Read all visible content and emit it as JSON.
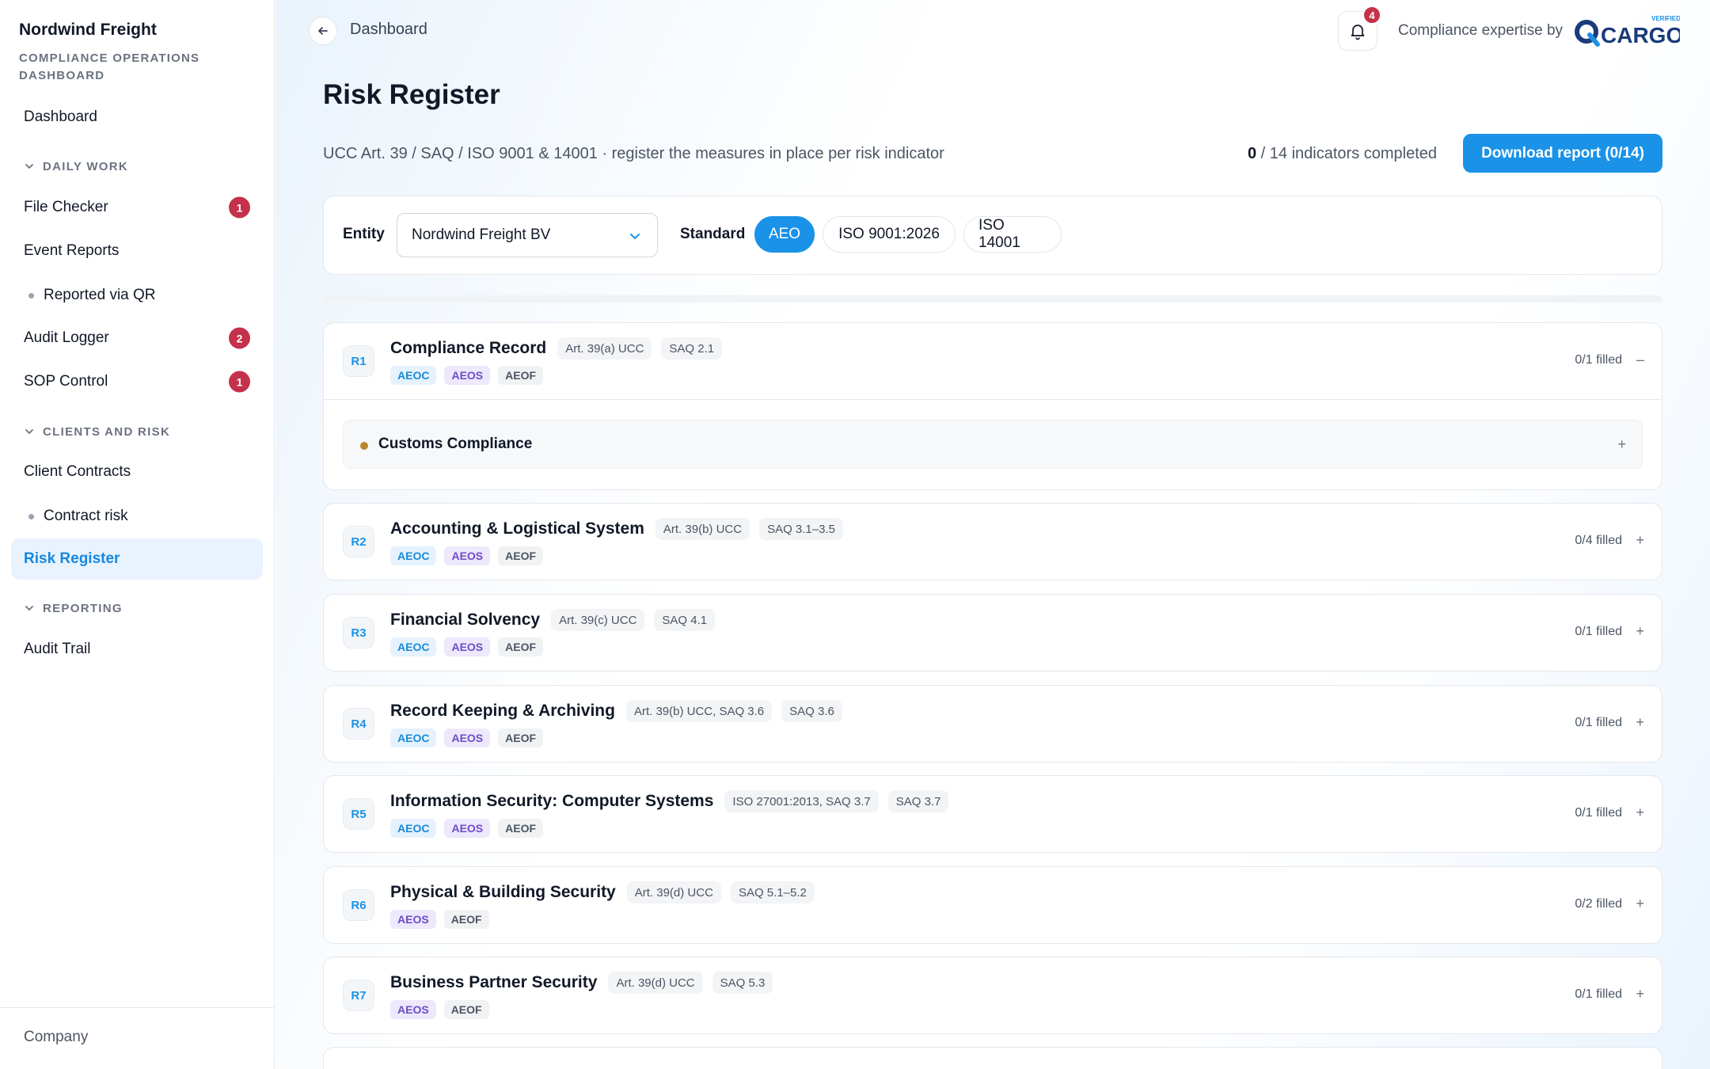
{
  "sidebar": {
    "brand": "Nordwind Freight",
    "brand_sub": "COMPLIANCE OPERATIONS DASHBOARD",
    "dashboard": "Dashboard",
    "sections": {
      "daily": "DAILY WORK",
      "clients": "CLIENTS AND RISK",
      "reporting": "REPORTING"
    },
    "items": {
      "file_checker": {
        "label": "File Checker",
        "badge": "1"
      },
      "event_reports": {
        "label": "Event Reports"
      },
      "reported_qr": {
        "label": "Reported via QR"
      },
      "audit_logger": {
        "label": "Audit Logger",
        "badge": "2"
      },
      "sop_control": {
        "label": "SOP Control",
        "badge": "1"
      },
      "client_contracts": {
        "label": "Client Contracts"
      },
      "contract_risk": {
        "label": "Contract risk"
      },
      "risk_register": {
        "label": "Risk Register"
      },
      "audit_trail": {
        "label": "Audit Trail"
      }
    },
    "footer": "Company"
  },
  "header": {
    "breadcrumb": "Dashboard",
    "notifications": "4",
    "expertise": "Compliance expertise by",
    "logo_text": "CARGO",
    "logo_badge": "VERIFIED"
  },
  "page": {
    "title": "Risk Register",
    "subtitle": "UCC Art. 39 / SAQ / ISO 9001 & 14001 · register the measures in place per risk indicator",
    "completed": "0",
    "completed_rest": " / 14 indicators completed",
    "download": "Download report (0/14)"
  },
  "filters": {
    "entity_label": "Entity",
    "entity_value": "Nordwind Freight BV",
    "standard_label": "Standard",
    "standards": [
      "AEO",
      "ISO 9001:2026",
      "ISO 14001"
    ]
  },
  "risks": [
    {
      "id": "R1",
      "title": "Compliance Record",
      "refs": [
        "Art. 39(a) UCC",
        "SAQ 2.1"
      ],
      "tags": [
        "AEOC",
        "AEOS",
        "AEOF"
      ],
      "filled": "0/1 filled",
      "toggle": "–",
      "sub": "Customs Compliance",
      "sub_toggle": "+"
    },
    {
      "id": "R2",
      "title": "Accounting & Logistical System",
      "refs": [
        "Art. 39(b) UCC",
        "SAQ 3.1–3.5"
      ],
      "tags": [
        "AEOC",
        "AEOS",
        "AEOF"
      ],
      "filled": "0/4 filled",
      "toggle": "+"
    },
    {
      "id": "R3",
      "title": "Financial Solvency",
      "refs": [
        "Art. 39(c) UCC",
        "SAQ 4.1"
      ],
      "tags": [
        "AEOC",
        "AEOS",
        "AEOF"
      ],
      "filled": "0/1 filled",
      "toggle": "+"
    },
    {
      "id": "R4",
      "title": "Record Keeping & Archiving",
      "refs": [
        "Art. 39(b) UCC, SAQ 3.6",
        "SAQ 3.6"
      ],
      "tags": [
        "AEOC",
        "AEOS",
        "AEOF"
      ],
      "filled": "0/1 filled",
      "toggle": "+"
    },
    {
      "id": "R5",
      "title": "Information Security: Computer Systems",
      "refs": [
        "ISO 27001:2013, SAQ 3.7",
        "SAQ 3.7"
      ],
      "tags": [
        "AEOC",
        "AEOS",
        "AEOF"
      ],
      "filled": "0/1 filled",
      "toggle": "+"
    },
    {
      "id": "R6",
      "title": "Physical & Building Security",
      "refs": [
        "Art. 39(d) UCC",
        "SAQ 5.1–5.2"
      ],
      "tags": [
        "AEOS",
        "AEOF"
      ],
      "filled": "0/2 filled",
      "toggle": "+"
    },
    {
      "id": "R7",
      "title": "Business Partner Security",
      "refs": [
        "Art. 39(d) UCC",
        "SAQ 5.3"
      ],
      "tags": [
        "AEOS",
        "AEOF"
      ],
      "filled": "0/1 filled",
      "toggle": "+"
    }
  ],
  "colors": {
    "accent": "#1a92e8",
    "badge": "#c5304a",
    "active_nav_bg": "#e8f3fd"
  }
}
